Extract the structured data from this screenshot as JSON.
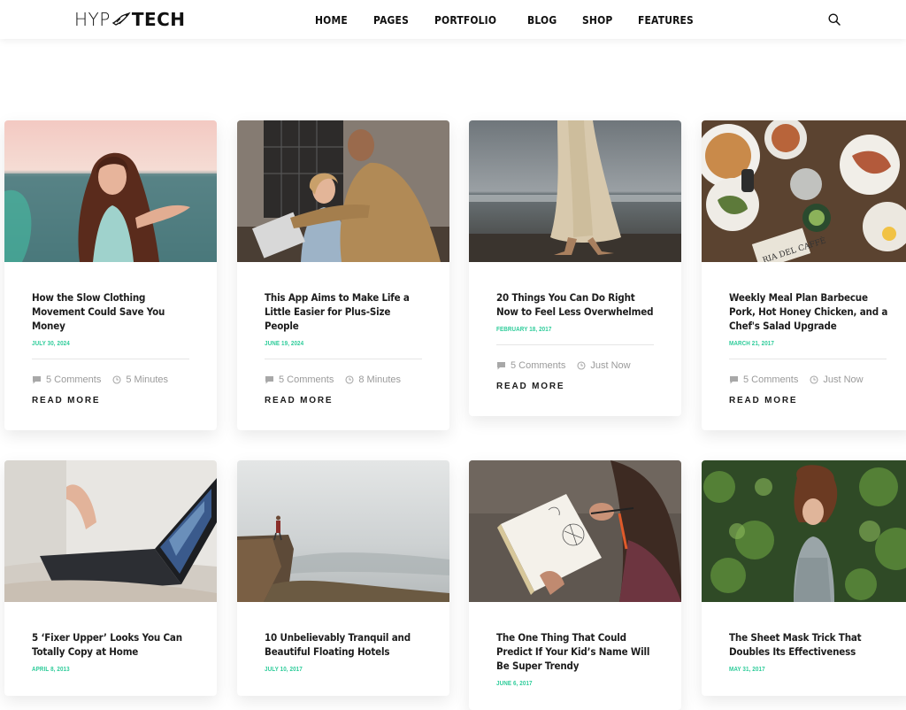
{
  "site": {
    "logo_left": "HYP",
    "logo_right": "TECH"
  },
  "nav": {
    "items": [
      {
        "label": "HOME"
      },
      {
        "label": "PAGES"
      },
      {
        "label": "PORTFOLIO"
      },
      {
        "label": "BLOG"
      },
      {
        "label": "SHOP"
      },
      {
        "label": "FEATURES"
      }
    ]
  },
  "icons": {
    "search": "search-icon",
    "comments": "comment-icon",
    "time": "clock-icon"
  },
  "colors": {
    "accent": "#2ecc9a",
    "text": "#1a1a1a",
    "meta": "#9a9a9a"
  },
  "posts": [
    {
      "title": "How the Slow Clothing Movement Could Save You Money",
      "date": "JULY 30, 2024",
      "comments": "5 Comments",
      "time": "5 Minutes",
      "read_more": "READ MORE",
      "image": "woman-by-sea"
    },
    {
      "title": "This App Aims to Make Life a Little Easier for Plus-Size People",
      "date": "JUNE 19, 2024",
      "comments": "5 Comments",
      "time": "8 Minutes",
      "read_more": "READ MORE",
      "image": "office-meeting"
    },
    {
      "title": "20 Things You Can Do Right Now to Feel Less Overwhelmed",
      "date": "FEBRUARY 18, 2017",
      "comments": "5 Comments",
      "time": "Just Now",
      "read_more": "READ MORE",
      "image": "beach-walk"
    },
    {
      "title": "Weekly Meal Plan Barbecue Pork, Hot Honey Chicken, and a Chef's Salad Upgrade",
      "date": "MARCH 21, 2017",
      "comments": "5 Comments",
      "time": "Just Now",
      "read_more": "READ MORE",
      "image": "food-table"
    },
    {
      "title": "5 ‘Fixer Upper’ Looks You Can Totally Copy at Home",
      "date": "APRIL 8, 2013",
      "image": "laptop"
    },
    {
      "title": "10 Unbelievably Tranquil and Beautiful Floating Hotels",
      "date": "JULY 10, 2017",
      "image": "cliff-hiker"
    },
    {
      "title": "The One Thing That Could Predict If Your Kid’s Name Will Be Super Trendy",
      "date": "JUNE 6, 2017",
      "image": "sketchbook"
    },
    {
      "title": "The Sheet Mask Trick That Doubles Its Effectiveness",
      "date": "MAY 31, 2017",
      "image": "woman-in-forest"
    }
  ]
}
